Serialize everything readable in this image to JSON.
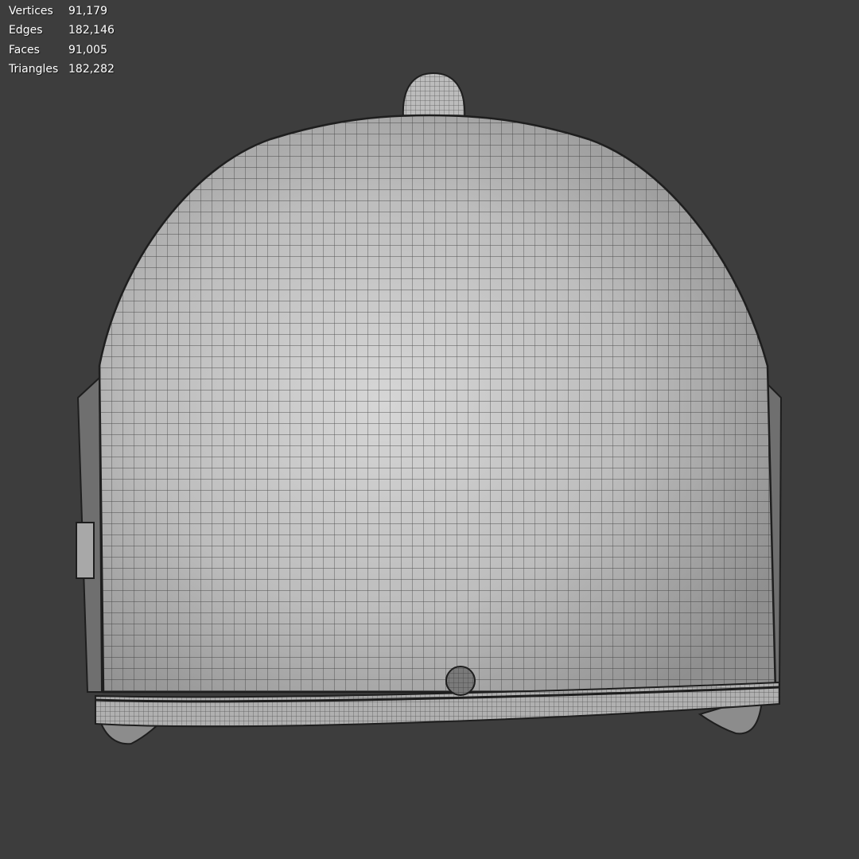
{
  "overlay_stats": [
    {
      "label": "Vertices",
      "value": "91,179"
    },
    {
      "label": "Edges",
      "value": "182,146"
    },
    {
      "label": "Faces",
      "value": "91,005"
    },
    {
      "label": "Triangles",
      "value": "182,282"
    }
  ],
  "colors": {
    "background": "#3d3d3d",
    "mesh_surface": "#b9b9b9",
    "wire": "#2b2b2b"
  }
}
